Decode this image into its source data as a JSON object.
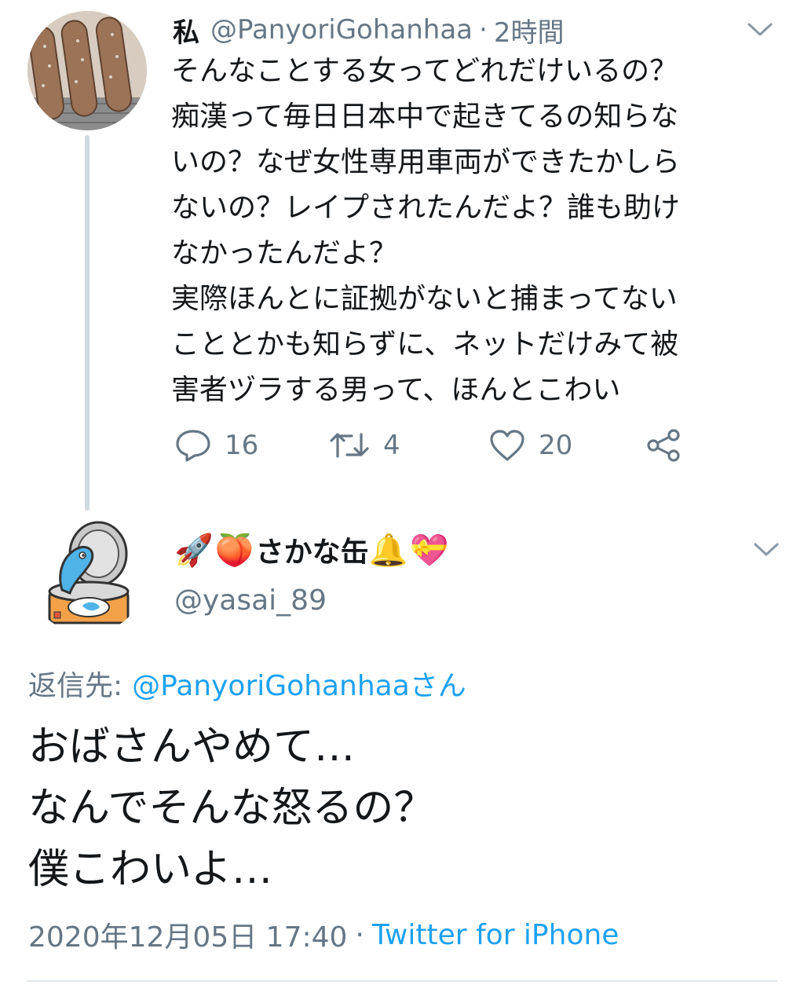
{
  "tweet1": {
    "author_name": "私",
    "author_handle": "@PanyoriGohanhaa",
    "separator": "·",
    "time_ago": "2時間",
    "avatar_icon": "bread-photo-avatar",
    "body_lines": [
      "そんなことする女ってどれだけいるの？",
      "痴漢って毎日日本中で起きてるの知らな",
      "いの？なぜ女性専用車両ができたかしら",
      "ないの？レイプされたんだよ？誰も助け",
      "なかったんだよ？",
      "実際ほんとに証拠がないと捕まってない",
      "こととかも知らずに、ネットだけみて被",
      "害者ヅラする男って、ほんとこわい"
    ],
    "actions": {
      "reply_count": "16",
      "retweet_count": "4",
      "like_count": "20"
    }
  },
  "tweet2": {
    "display_name": "さかな缶",
    "name_emojis_before": [
      "🚀",
      "🍑"
    ],
    "name_emojis_after": [
      "🔔",
      "💝"
    ],
    "handle": "@yasai_89",
    "avatar_icon": "fish-can-avatar",
    "reply_to_label": "返信先:",
    "reply_to_link": "@PanyoriGohanhaaさん",
    "body_lines": [
      "おばさんやめて…",
      "なんでそんな怒るの？",
      "僕こわいよ…"
    ],
    "timestamp": "2020年12月05日 17:40",
    "separator": "·",
    "source": "Twitter for iPhone"
  },
  "colors": {
    "text": "#14171a",
    "secondary": "#657786",
    "link": "#1da1f2",
    "thread_line": "#cfd9de"
  }
}
